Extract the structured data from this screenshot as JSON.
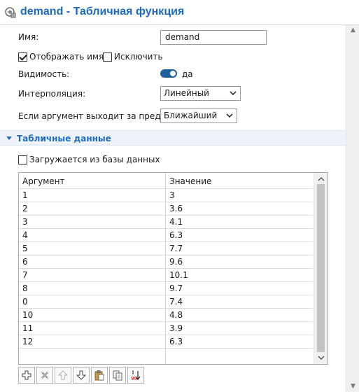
{
  "header": {
    "title": "demand - Табличная функция",
    "icon": "table-function-icon"
  },
  "form": {
    "name_label": "Имя:",
    "name_value": "demand",
    "show_name_label": "Отображать имя",
    "show_name_checked": true,
    "exclude_label": "Исключить",
    "exclude_checked": false,
    "visibility_label": "Видимость:",
    "visibility_value": "да",
    "interpolation_label": "Интерполяция:",
    "interpolation_value": "Линейный",
    "out_of_range_label": "Если аргумент выходит за пределы:",
    "out_of_range_value": "Ближайший"
  },
  "section": {
    "title": "Табличные данные",
    "load_from_db_label": "Загружается из базы данных",
    "load_from_db_checked": false
  },
  "table": {
    "columns": [
      "Аргумент",
      "Значение"
    ],
    "rows": [
      [
        "1",
        "3"
      ],
      [
        "2",
        "3.6"
      ],
      [
        "3",
        "4.1"
      ],
      [
        "4",
        "6.3"
      ],
      [
        "5",
        "7.7"
      ],
      [
        "6",
        "9.6"
      ],
      [
        "7",
        "10.1"
      ],
      [
        "8",
        "9.7"
      ],
      [
        "0",
        "7.4"
      ],
      [
        "10",
        "4.8"
      ],
      [
        "11",
        "3.9"
      ],
      [
        "12",
        "6.3"
      ],
      [
        "",
        ""
      ]
    ]
  },
  "toolbar": {
    "buttons": [
      "add-row-icon",
      "delete-row-icon",
      "move-up-icon",
      "move-down-icon",
      "paste-icon",
      "copy-icon",
      "sort-icon"
    ]
  },
  "colors": {
    "accent": "#1e6bb8",
    "toggle_on": "#1f5f9e"
  }
}
